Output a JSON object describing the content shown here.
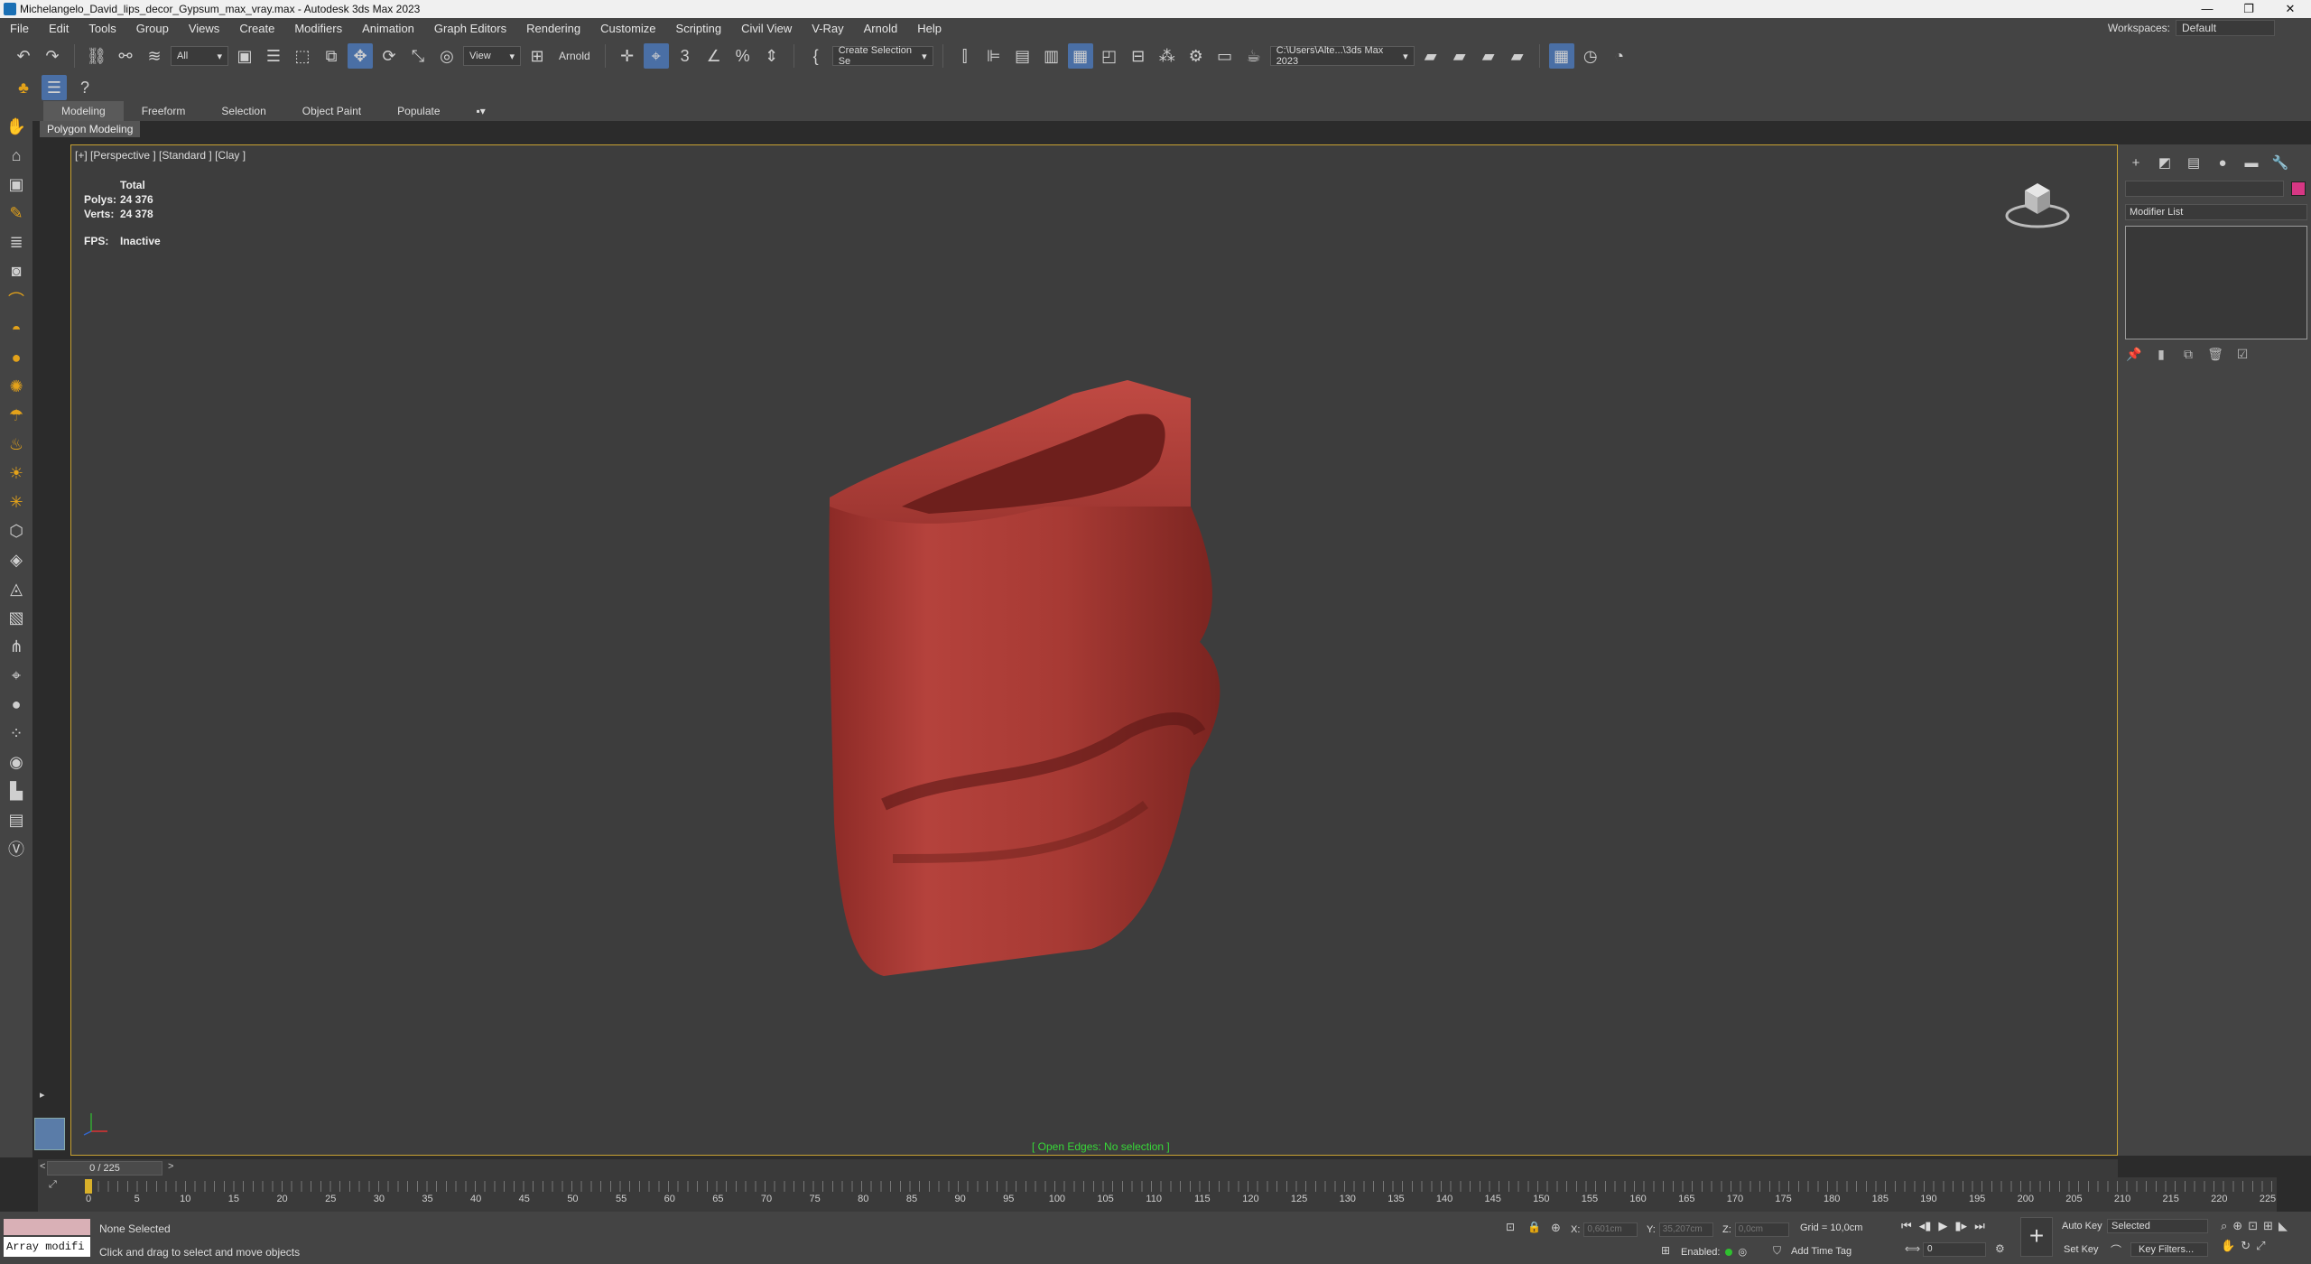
{
  "window": {
    "title": "Michelangelo_David_lips_decor_Gypsum_max_vray.max - Autodesk 3ds Max 2023",
    "controls": [
      "—",
      "❐",
      "✕"
    ]
  },
  "menu": {
    "items": [
      "File",
      "Edit",
      "Tools",
      "Group",
      "Views",
      "Create",
      "Modifiers",
      "Animation",
      "Graph Editors",
      "Rendering",
      "Customize",
      "Scripting",
      "Civil View",
      "V-Ray",
      "Arnold",
      "Help"
    ],
    "workspace_label": "Workspaces:",
    "workspace_value": "Default"
  },
  "toolbar": {
    "selection_filter": "All",
    "ref_coord": "View",
    "arnold_label": "Arnold",
    "named_selection": "Create Selection Se",
    "project_path": "C:\\Users\\Alte...\\3ds Max 2023"
  },
  "ribbon": {
    "tabs": [
      "Modeling",
      "Freeform",
      "Selection",
      "Object Paint",
      "Populate"
    ],
    "panel": "Polygon Modeling"
  },
  "viewport": {
    "label": "[+] [Perspective ] [Standard ] [Clay ]",
    "stats": {
      "total_label": "Total",
      "polys_label": "Polys:",
      "polys_value": "24 376",
      "verts_label": "Verts:",
      "verts_value": "24 378",
      "fps_label": "FPS:",
      "fps_value": "Inactive"
    },
    "status": "[ Open Edges: No selection ]",
    "model_color": "#a83a35"
  },
  "command_panel": {
    "modifier_list": "Modifier List",
    "color_swatch": "#d63784"
  },
  "timeline": {
    "frame_display": "0 / 225",
    "ticks": [
      "0",
      "5",
      "10",
      "15",
      "20",
      "25",
      "30",
      "35",
      "40",
      "45",
      "50",
      "55",
      "60",
      "65",
      "70",
      "75",
      "80",
      "85",
      "90",
      "95",
      "100",
      "105",
      "110",
      "115",
      "120",
      "125",
      "130",
      "135",
      "140",
      "145",
      "150",
      "155",
      "160",
      "165",
      "170",
      "175",
      "180",
      "185",
      "190",
      "195",
      "200",
      "205",
      "210",
      "215",
      "220",
      "225"
    ]
  },
  "status": {
    "maxscript_input": "Array modifi",
    "selection_info": "None Selected",
    "prompt": "Click and drag to select and move objects",
    "x_label": "X:",
    "x_value": "0,601cm",
    "y_label": "Y:",
    "y_value": "35,207cm",
    "z_label": "Z:",
    "z_value": "0,0cm",
    "grid": "Grid = 10,0cm",
    "enabled_label": "Enabled:",
    "add_time_tag": "Add Time Tag",
    "auto_key": "Auto Key",
    "set_key": "Set Key",
    "selected_dropdown": "Selected",
    "key_filters": "Key Filters...",
    "current_frame": "0"
  }
}
